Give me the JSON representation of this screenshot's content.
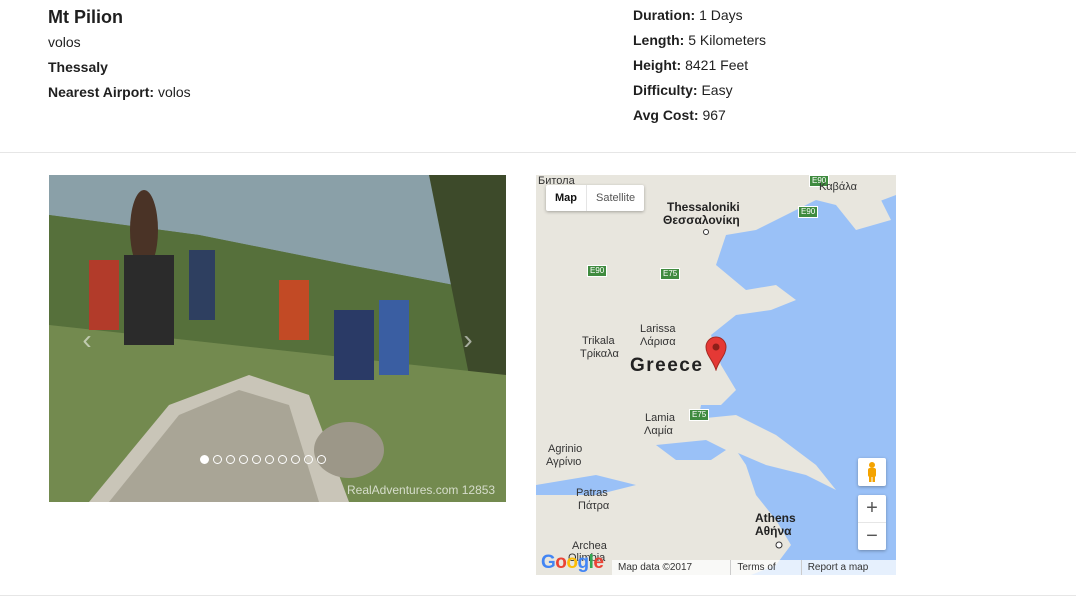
{
  "trip": {
    "title": "Mt Pilion",
    "location": "volos",
    "region": "Thessaly",
    "airport_label": "Nearest Airport:",
    "airport_value": "volos"
  },
  "stats": [
    {
      "label": "Duration:",
      "value": "1 Days"
    },
    {
      "label": "Length:",
      "value": "5 Kilometers"
    },
    {
      "label": "Height:",
      "value": "8421 Feet"
    },
    {
      "label": "Difficulty:",
      "value": "Easy"
    },
    {
      "label": "Avg Cost:",
      "value": "967"
    }
  ],
  "carousel": {
    "prev_icon": "chevron-left-icon",
    "next_icon": "chevron-right-icon",
    "prev_glyph": "‹",
    "next_glyph": "›",
    "slide_count": 10,
    "active_slide": 1,
    "watermark": "RealAdventures.com 12853"
  },
  "map": {
    "type_map": "Map",
    "type_satellite": "Satellite",
    "zoom_in": "+",
    "zoom_out": "−",
    "labels": {
      "greece": "Greece",
      "thessaloniki": "Thessaloniki",
      "thessaloniki_gr": "Θεσσαλονίκη",
      "larissa": "Larissa",
      "larissa_gr": "Λάρισα",
      "trikala": "Trikala",
      "trikala_gr": "Τρίκαλα",
      "lamia": "Lamia",
      "lamia_gr": "Λαμία",
      "agrinio": "Agrinio",
      "agrinio_gr": "Αγρίνιο",
      "patras": "Patras",
      "patras_gr": "Πάτρα",
      "athens": "Athens",
      "athens_gr": "Αθήνα",
      "kavala": "Καβάλα",
      "bitola": "Битола",
      "archea": "Archea",
      "olimbia": "Olimbia"
    },
    "shields": [
      "E90",
      "E90",
      "E90",
      "E75",
      "E75"
    ],
    "data_text": "Map data ©2017 Google",
    "terms": "Terms of Use",
    "report": "Report a map error",
    "colors": {
      "water": "#9ac1f7",
      "land": "#e8e6de",
      "marker": "#e53935"
    }
  }
}
